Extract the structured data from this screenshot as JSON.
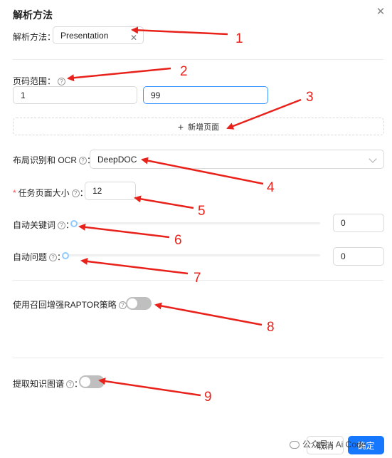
{
  "dialog": {
    "title": "解析方法"
  },
  "parser": {
    "label": "解析方法",
    "value": "Presentation"
  },
  "page_range": {
    "label": "页码范围",
    "start": "1",
    "end": "99",
    "add_label": "新增页面"
  },
  "layout": {
    "label": "布局识别和 OCR",
    "value": "DeepDOC"
  },
  "task_size": {
    "label": "任务页面大小",
    "value": "12"
  },
  "auto_keywords": {
    "label": "自动关键词",
    "value": "0",
    "level": 0
  },
  "auto_questions": {
    "label": "自动问题",
    "value": "0",
    "level": 0
  },
  "raptor": {
    "label": "使用召回增强RAPTOR策略",
    "on": false
  },
  "knowledge_graph": {
    "label": "提取知识图谱",
    "on": false
  },
  "footer": {
    "cancel": "取消",
    "ok": "确定"
  },
  "watermark": {
    "text": "公众号 · Ai Code"
  },
  "annotations": [
    "1",
    "2",
    "3",
    "4",
    "5",
    "6",
    "7",
    "8",
    "9"
  ],
  "colors": {
    "primary": "#1677ff",
    "annotation": "#e8221b",
    "switch_off": "#bfbfbf",
    "required": "#ff4d4f"
  }
}
